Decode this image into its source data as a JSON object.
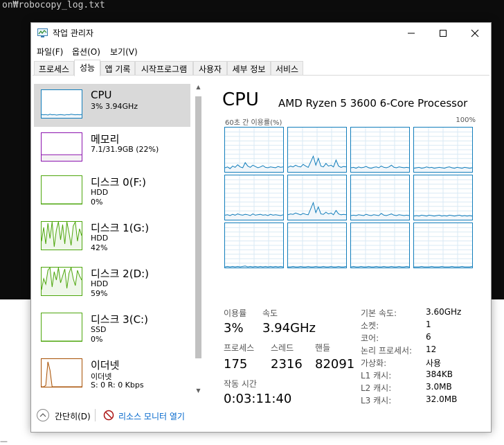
{
  "terminal": {
    "line": "on₩robocopy_log.txt"
  },
  "window": {
    "title": "작업 관리자",
    "accent": "#117dbb",
    "selected_bg": "#d9d9d9"
  },
  "menu": [
    {
      "label": "파일(F)"
    },
    {
      "label": "옵션(O)"
    },
    {
      "label": "보기(V)"
    }
  ],
  "tabs": [
    {
      "label": "프로세스"
    },
    {
      "label": "성능"
    },
    {
      "label": "앱 기록"
    },
    {
      "label": "시작프로그램"
    },
    {
      "label": "사용자"
    },
    {
      "label": "세부 정보"
    },
    {
      "label": "서비스"
    }
  ],
  "active_tab": "성능",
  "sidebar": {
    "items": [
      {
        "name": "CPU",
        "sub": "3% 3.94GHz",
        "sub2": "",
        "color": "#117dbb",
        "fill": "#f1f6fa",
        "series": [
          12,
          11,
          12,
          10,
          13,
          11,
          12,
          10,
          11,
          12,
          11,
          10,
          12,
          11,
          13,
          12,
          11,
          12,
          11,
          12
        ]
      },
      {
        "name": "메모리",
        "sub": "7.1/31.9GB (22%)",
        "sub2": "",
        "color": "#8b12ae",
        "fill": "#f4f2f4",
        "series": [
          22,
          22,
          22,
          22,
          22,
          22,
          22,
          22,
          22,
          22,
          22,
          22,
          22,
          22,
          22,
          22,
          22,
          22,
          22,
          22
        ]
      },
      {
        "name": "디스크 0(F:)",
        "sub": "HDD",
        "sub2": "0%",
        "color": "#4da60c",
        "fill": "#eff7ea",
        "series": [
          0,
          0,
          0,
          0,
          0,
          0,
          0,
          0,
          0,
          0,
          0,
          0,
          0,
          0,
          0,
          0,
          0,
          0,
          0,
          0
        ]
      },
      {
        "name": "디스크 1(G:)",
        "sub": "HDD",
        "sub2": "42%",
        "color": "#4da60c",
        "fill": "#eff7ea",
        "series": [
          30,
          80,
          20,
          95,
          40,
          100,
          10,
          70,
          100,
          35,
          90,
          20,
          100,
          60,
          15,
          85,
          100,
          30,
          75,
          50
        ]
      },
      {
        "name": "디스크 2(D:)",
        "sub": "HDD",
        "sub2": "59%",
        "color": "#4da60c",
        "fill": "#eff7ea",
        "series": [
          20,
          60,
          40,
          90,
          100,
          30,
          85,
          55,
          100,
          45,
          70,
          95,
          25,
          80,
          100,
          60,
          35,
          90,
          70,
          55
        ]
      },
      {
        "name": "디스크 3(C:)",
        "sub": "SSD",
        "sub2": "0%",
        "color": "#4da60c",
        "fill": "#eff7ea",
        "series": [
          0,
          0,
          0,
          0,
          0,
          0,
          0,
          0,
          0,
          0,
          0,
          0,
          0,
          0,
          0,
          0,
          0,
          0,
          0,
          0
        ]
      },
      {
        "name": "이더넷",
        "sub": "이더넷",
        "sub2": "S: 0 R: 0 Kbps",
        "color": "#a74f01",
        "fill": "#fcf3eb",
        "series": [
          0,
          0,
          5,
          90,
          60,
          0,
          0,
          0,
          0,
          0,
          0,
          0,
          0,
          0,
          0,
          0,
          0,
          0,
          0,
          0
        ]
      }
    ]
  },
  "main": {
    "title": "CPU",
    "processor": "AMD Ryzen 5 3600 6-Core Processor",
    "graph_label": "60초 간 이용률(%)",
    "graph_max": "100%",
    "stats": {
      "util_label": "이용률",
      "util": "3%",
      "speed_label": "속도",
      "speed": "3.94GHz",
      "proc_label": "프로세스",
      "procs": "175",
      "threads_label": "스레드",
      "threads": "2316",
      "handles_label": "핸들",
      "handles": "82091",
      "uptime_label": "작동 시간",
      "uptime": "0:03:11:40"
    },
    "info": [
      {
        "k": "기본 속도:",
        "v": "3.60GHz"
      },
      {
        "k": "소켓:",
        "v": "1"
      },
      {
        "k": "코어:",
        "v": "6"
      },
      {
        "k": "논리 프로세서:",
        "v": "12"
      },
      {
        "k": "가상화:",
        "v": "사용"
      },
      {
        "k": "L1 캐시:",
        "v": "384KB"
      },
      {
        "k": "L2 캐시:",
        "v": "3.0MB"
      },
      {
        "k": "L3 캐시:",
        "v": "32.0MB"
      }
    ],
    "cores": [
      [
        8,
        10,
        6,
        12,
        9,
        15,
        10,
        8,
        20,
        12,
        9,
        14,
        11,
        8,
        10,
        13,
        9,
        8,
        10,
        9,
        8,
        11,
        9,
        10
      ],
      [
        9,
        12,
        10,
        14,
        11,
        10,
        16,
        12,
        9,
        22,
        35,
        14,
        30,
        12,
        10,
        18,
        12,
        14,
        10,
        26,
        12,
        9,
        11,
        10
      ],
      [
        8,
        9,
        7,
        10,
        8,
        9,
        11,
        8,
        7,
        9,
        10,
        8,
        12,
        9,
        8,
        10,
        14,
        9,
        8,
        10,
        9,
        8,
        9,
        8
      ],
      [
        7,
        8,
        9,
        7,
        8,
        10,
        8,
        9,
        7,
        8,
        9,
        8,
        7,
        9,
        10,
        8,
        7,
        9,
        8,
        7,
        9,
        8,
        7,
        8
      ],
      [
        9,
        10,
        8,
        11,
        9,
        12,
        10,
        9,
        11,
        10,
        8,
        12,
        9,
        10,
        11,
        9,
        10,
        8,
        11,
        9,
        10,
        9,
        8,
        10
      ],
      [
        10,
        12,
        11,
        14,
        12,
        10,
        13,
        11,
        10,
        24,
        38,
        15,
        28,
        12,
        11,
        16,
        12,
        14,
        10,
        20,
        12,
        10,
        11,
        10
      ],
      [
        8,
        9,
        8,
        10,
        9,
        8,
        11,
        9,
        8,
        10,
        9,
        8,
        13,
        9,
        8,
        10,
        12,
        9,
        8,
        10,
        9,
        8,
        9,
        8
      ],
      [
        7,
        8,
        7,
        9,
        8,
        7,
        9,
        8,
        7,
        8,
        9,
        7,
        8,
        7,
        9,
        8,
        7,
        8,
        9,
        7,
        8,
        7,
        8,
        7
      ],
      [
        0,
        1,
        0,
        1,
        0,
        1,
        0,
        1,
        2,
        0,
        1,
        0,
        1,
        0,
        1,
        0,
        1,
        0,
        1,
        0,
        1,
        0,
        1,
        0
      ],
      [
        0,
        0,
        1,
        0,
        0,
        1,
        0,
        0,
        1,
        0,
        0,
        1,
        0,
        0,
        1,
        0,
        0,
        1,
        0,
        0,
        1,
        0,
        0,
        1
      ],
      [
        0,
        1,
        0,
        0,
        1,
        0,
        0,
        1,
        0,
        0,
        1,
        0,
        0,
        1,
        0,
        0,
        1,
        0,
        0,
        1,
        0,
        0,
        1,
        0
      ],
      [
        0,
        0,
        0,
        1,
        0,
        0,
        0,
        1,
        0,
        0,
        0,
        1,
        0,
        0,
        0,
        1,
        0,
        0,
        0,
        1,
        0,
        0,
        0,
        1
      ]
    ]
  },
  "footer": {
    "fewer": "간단히(D)",
    "resmon": "리소스 모니터 열기"
  },
  "bottom_cut": "—"
}
